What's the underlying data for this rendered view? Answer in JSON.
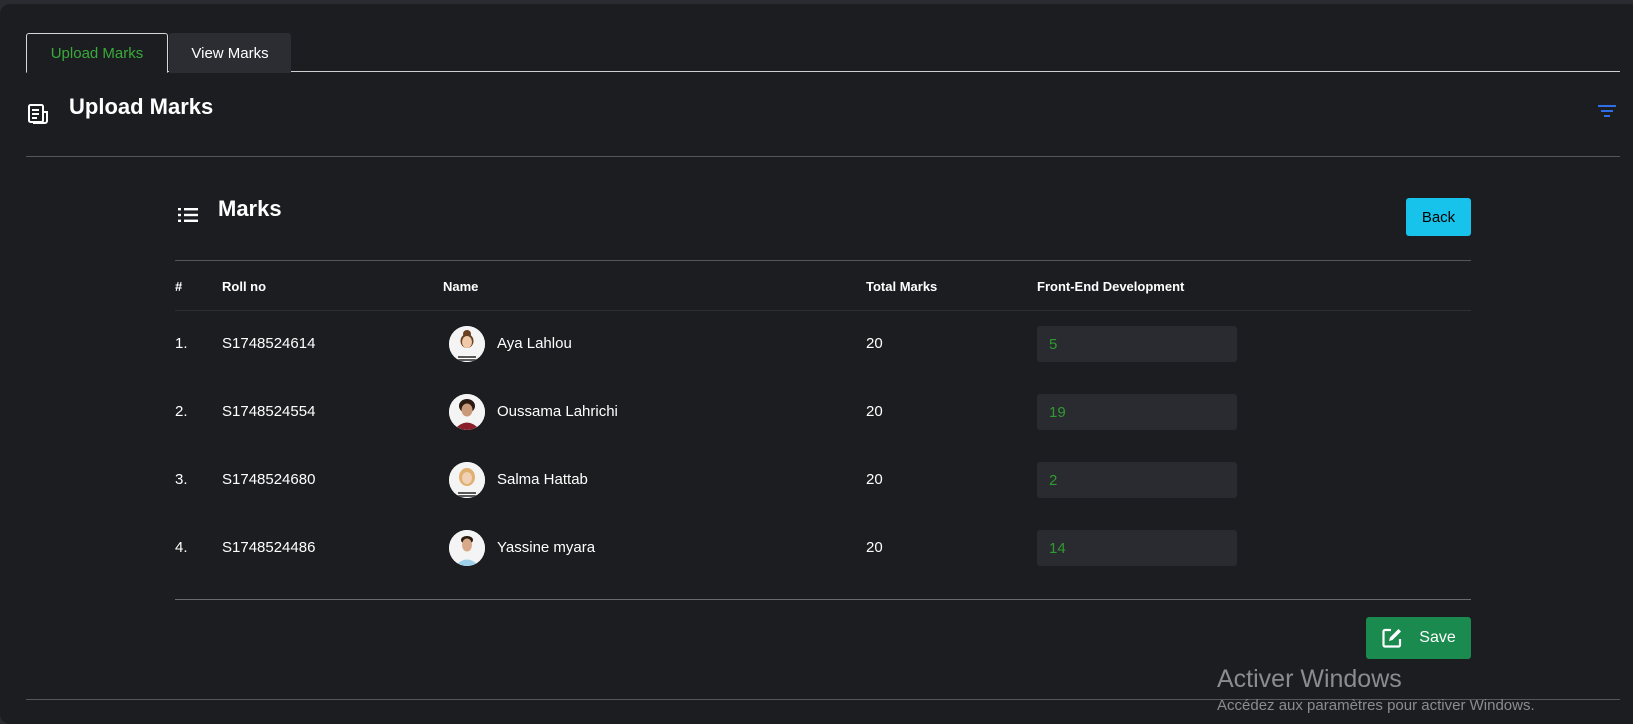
{
  "tabs": [
    {
      "label": "Upload Marks",
      "active": true
    },
    {
      "label": "View Marks",
      "active": false
    }
  ],
  "header": {
    "title": "Upload Marks",
    "icon": "document-icon",
    "filter_icon": "filter-icon"
  },
  "panel": {
    "title": "Marks",
    "icon": "list-icon",
    "back_label": "Back",
    "save_label": "Save",
    "save_icon": "edit-icon"
  },
  "table": {
    "headers": {
      "num": "#",
      "roll": "Roll no",
      "name": "Name",
      "total": "Total Marks",
      "subject": "Front-End Development"
    },
    "rows": [
      {
        "num": "1.",
        "roll": "S1748524614",
        "name": "Aya Lahlou",
        "total": "20",
        "mark": "5"
      },
      {
        "num": "2.",
        "roll": "S1748524554",
        "name": "Oussama Lahrichi",
        "total": "20",
        "mark": "19"
      },
      {
        "num": "3.",
        "roll": "S1748524680",
        "name": "Salma Hattab",
        "total": "20",
        "mark": "2"
      },
      {
        "num": "4.",
        "roll": "S1748524486",
        "name": "Yassine myara",
        "total": "20",
        "mark": "14"
      }
    ]
  },
  "watermark": {
    "title": "Activer Windows",
    "subtitle": "Accédez aux paramètres pour activer Windows."
  },
  "colors": {
    "background": "#1c1d21",
    "active_tab_text": "#3aaa3a",
    "back_button": "#17c3ea",
    "save_button": "#1a8a4e",
    "mark_text": "#2f9a2f",
    "filter_icon": "#2f6fe6"
  }
}
